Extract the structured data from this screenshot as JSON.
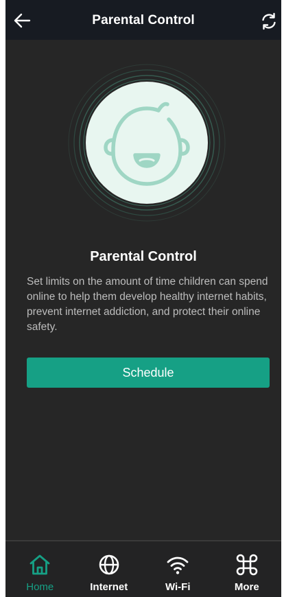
{
  "header": {
    "title": "Parental Control",
    "back_icon": "arrow-left-icon",
    "refresh_icon": "refresh-icon"
  },
  "hero": {
    "icon": "baby-face-icon",
    "circle_color": "#e8f6f0",
    "accent_color": "#9fd6c4"
  },
  "content": {
    "title": "Parental Control",
    "description": "Set limits on the amount of time children can spend online to help them develop healthy internet habits, prevent internet addiction, and protect their online safety."
  },
  "actions": {
    "schedule_label": "Schedule"
  },
  "tabbar": {
    "items": [
      {
        "label": "Home",
        "icon": "home-icon",
        "active": true
      },
      {
        "label": "Internet",
        "icon": "globe-icon",
        "active": false
      },
      {
        "label": "Wi-Fi",
        "icon": "wifi-icon",
        "active": false
      },
      {
        "label": "More",
        "icon": "command-icon",
        "active": false
      }
    ]
  },
  "colors": {
    "background": "#262626",
    "header": "#171b22",
    "accent": "#16a085",
    "text_primary": "#ffffff",
    "text_secondary": "#bdbdbd"
  }
}
